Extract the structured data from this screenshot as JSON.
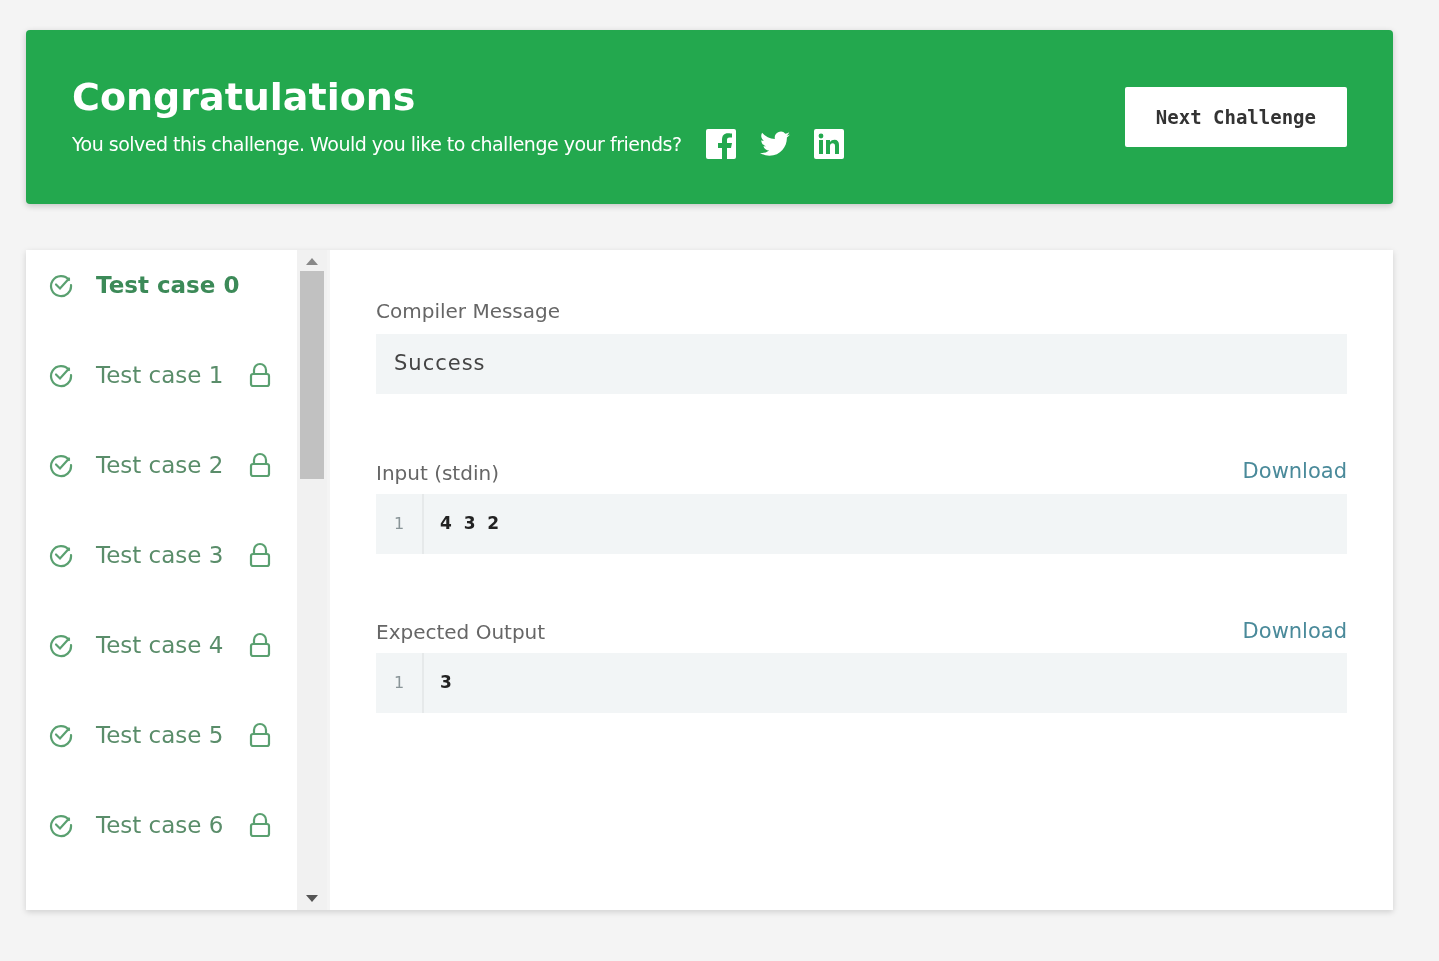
{
  "banner": {
    "title": "Congratulations",
    "message": "You solved this challenge. Would you like to challenge your friends?",
    "button": "Next Challenge"
  },
  "test_cases": [
    {
      "label": "Test case 0",
      "selected": true,
      "locked": false
    },
    {
      "label": "Test case 1",
      "selected": false,
      "locked": true
    },
    {
      "label": "Test case 2",
      "selected": false,
      "locked": true
    },
    {
      "label": "Test case 3",
      "selected": false,
      "locked": true
    },
    {
      "label": "Test case 4",
      "selected": false,
      "locked": true
    },
    {
      "label": "Test case 5",
      "selected": false,
      "locked": true
    },
    {
      "label": "Test case 6",
      "selected": false,
      "locked": true
    }
  ],
  "compiler_message": {
    "label": "Compiler Message",
    "value": "Success"
  },
  "input": {
    "label": "Input (stdin)",
    "download": "Download",
    "lines": [
      {
        "number": "1",
        "text": "4  3  2"
      }
    ]
  },
  "expected_output": {
    "label": "Expected Output",
    "download": "Download",
    "lines": [
      {
        "number": "1",
        "text": "3"
      }
    ]
  }
}
